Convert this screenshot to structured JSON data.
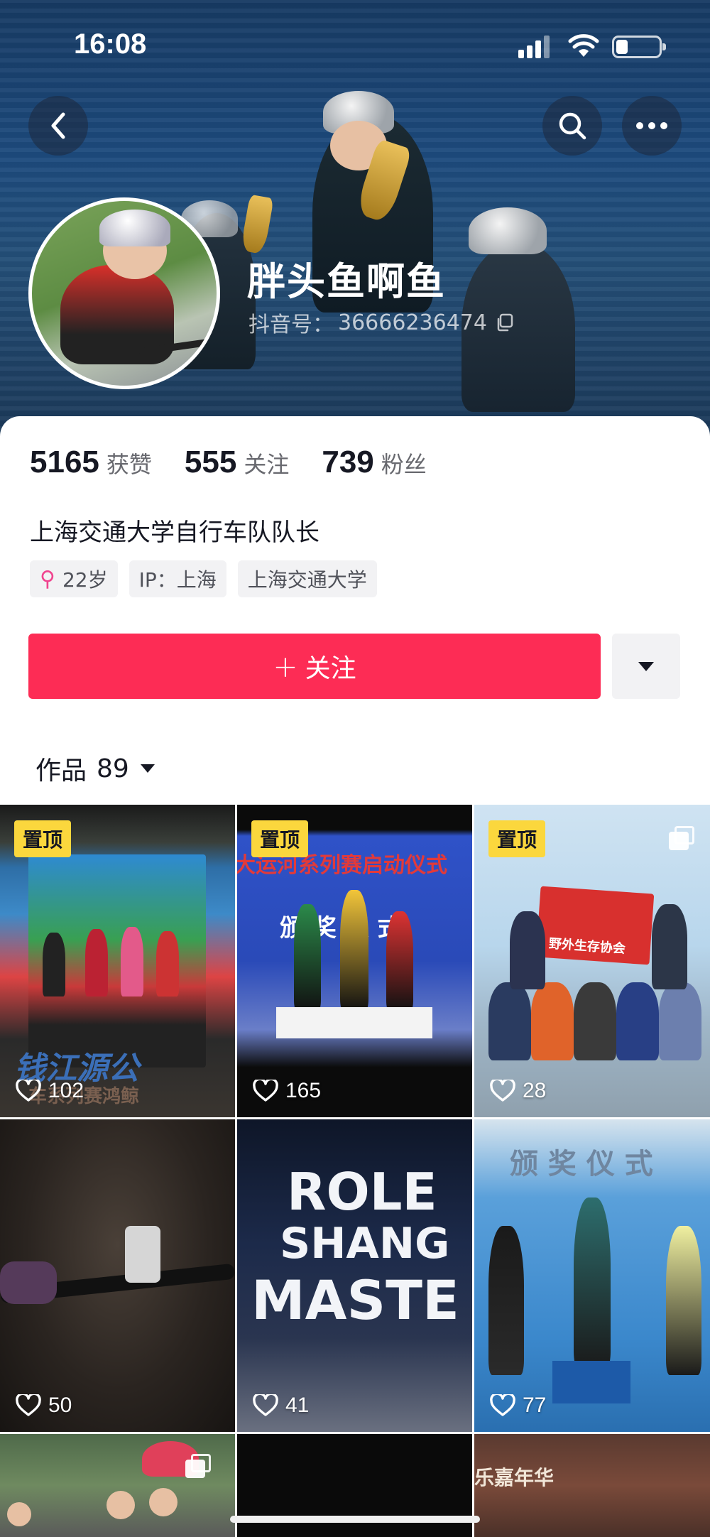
{
  "status_bar": {
    "time": "16:08"
  },
  "header": {
    "nickname": "胖头鱼啊鱼",
    "douyin_id_label": "抖音号：",
    "douyin_id": "36666236474"
  },
  "stats": [
    {
      "value": "5165",
      "label": "获赞"
    },
    {
      "value": "555",
      "label": "关注"
    },
    {
      "value": "739",
      "label": "粉丝"
    }
  ],
  "bio": "上海交通大学自行车队队长",
  "tags": [
    {
      "text": "22岁",
      "icon": "female-icon"
    },
    {
      "text": "IP：上海"
    },
    {
      "text": "上海交通大学"
    }
  ],
  "follow_button_label": "关注",
  "works_tab": {
    "label": "作品",
    "count": "89"
  },
  "pin_label": "置顶",
  "videos": [
    {
      "likes": "102",
      "pinned": true
    },
    {
      "likes": "165",
      "pinned": true
    },
    {
      "likes": "28",
      "pinned": true,
      "multi_image": true
    },
    {
      "likes": "50"
    },
    {
      "likes": "41"
    },
    {
      "likes": "77"
    }
  ],
  "scene_text": {
    "v1_banner": "钱江源公",
    "v1_sub": "车系列赛鸿鲸",
    "v2_banner": "大运河系列赛启动仪式",
    "v2_ceremony": "颁 奖 仪 式",
    "v3_flag": "野外生存协会",
    "v5_line1": "ROLE",
    "v5_line2": "SHANG",
    "v5_line3": "MASTE",
    "v6_title": "颁 奖 仪 式",
    "v9_sign": "乐嘉年华"
  },
  "colors": {
    "follow_red": "#fd2c55",
    "pin_yellow": "#fbd73d",
    "text_primary": "#161823",
    "text_secondary": "#68696f",
    "female_pink": "#f0448f"
  }
}
